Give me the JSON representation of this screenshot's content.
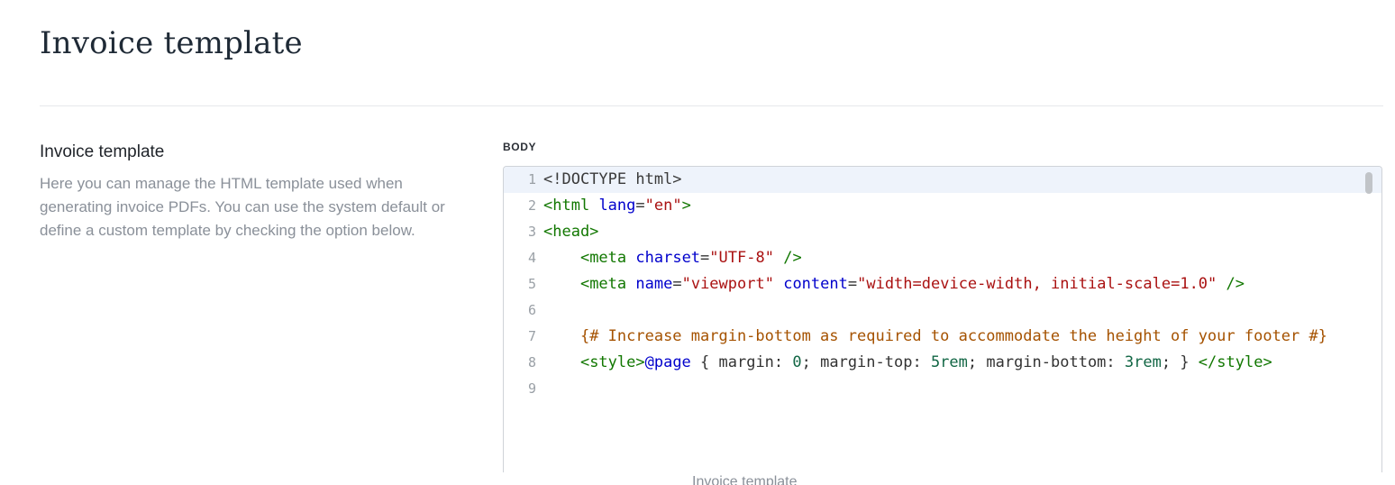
{
  "page": {
    "title": "Invoice template"
  },
  "section": {
    "title": "Invoice template",
    "description": "Here you can manage the HTML template used when generating invoice PDFs. You can use the system default or define a custom template by checking the option below."
  },
  "editor": {
    "label": "BODY",
    "lines": [
      {
        "n": "1",
        "tokens": [
          {
            "c": "doc",
            "t": "<!DOCTYPE html>"
          }
        ]
      },
      {
        "n": "2",
        "tokens": [
          {
            "c": "tag",
            "t": "<html"
          },
          {
            "c": "punc",
            "t": " "
          },
          {
            "c": "attr",
            "t": "lang"
          },
          {
            "c": "punc",
            "t": "="
          },
          {
            "c": "str",
            "t": "\"en\""
          },
          {
            "c": "tag",
            "t": ">"
          }
        ]
      },
      {
        "n": "3",
        "tokens": [
          {
            "c": "tag",
            "t": "<head>"
          }
        ]
      },
      {
        "n": "4",
        "tokens": [
          {
            "c": "punc",
            "t": "    "
          },
          {
            "c": "tag",
            "t": "<meta"
          },
          {
            "c": "punc",
            "t": " "
          },
          {
            "c": "attr",
            "t": "charset"
          },
          {
            "c": "punc",
            "t": "="
          },
          {
            "c": "str",
            "t": "\"UTF-8\""
          },
          {
            "c": "punc",
            "t": " "
          },
          {
            "c": "tag",
            "t": "/>"
          }
        ]
      },
      {
        "n": "5",
        "tokens": [
          {
            "c": "punc",
            "t": "    "
          },
          {
            "c": "tag",
            "t": "<meta"
          },
          {
            "c": "punc",
            "t": " "
          },
          {
            "c": "attr",
            "t": "name"
          },
          {
            "c": "punc",
            "t": "="
          },
          {
            "c": "str",
            "t": "\"viewport\""
          },
          {
            "c": "punc",
            "t": " "
          },
          {
            "c": "attr",
            "t": "content"
          },
          {
            "c": "punc",
            "t": "="
          },
          {
            "c": "str",
            "t": "\"width=device-width, initial-scale=1.0\""
          },
          {
            "c": "punc",
            "t": " "
          },
          {
            "c": "tag",
            "t": "/>"
          }
        ]
      },
      {
        "n": "6",
        "tokens": []
      },
      {
        "n": "7",
        "tokens": [
          {
            "c": "punc",
            "t": "    "
          },
          {
            "c": "cmt",
            "t": "{# Increase margin-bottom as required to accommodate the height of your footer #}"
          }
        ]
      },
      {
        "n": "8",
        "tokens": [
          {
            "c": "punc",
            "t": "    "
          },
          {
            "c": "tag",
            "t": "<style>"
          },
          {
            "c": "at",
            "t": "@page"
          },
          {
            "c": "punc",
            "t": " { margin: "
          },
          {
            "c": "num",
            "t": "0"
          },
          {
            "c": "punc",
            "t": "; margin-top: "
          },
          {
            "c": "num",
            "t": "5rem"
          },
          {
            "c": "punc",
            "t": "; margin-bottom: "
          },
          {
            "c": "num",
            "t": "3rem"
          },
          {
            "c": "punc",
            "t": "; } "
          },
          {
            "c": "tag",
            "t": "</style>"
          }
        ]
      },
      {
        "n": "9",
        "tokens": []
      }
    ]
  },
  "caption": "Invoice template",
  "icons": {
    "scrollbar": "scrollbar-thumb"
  }
}
